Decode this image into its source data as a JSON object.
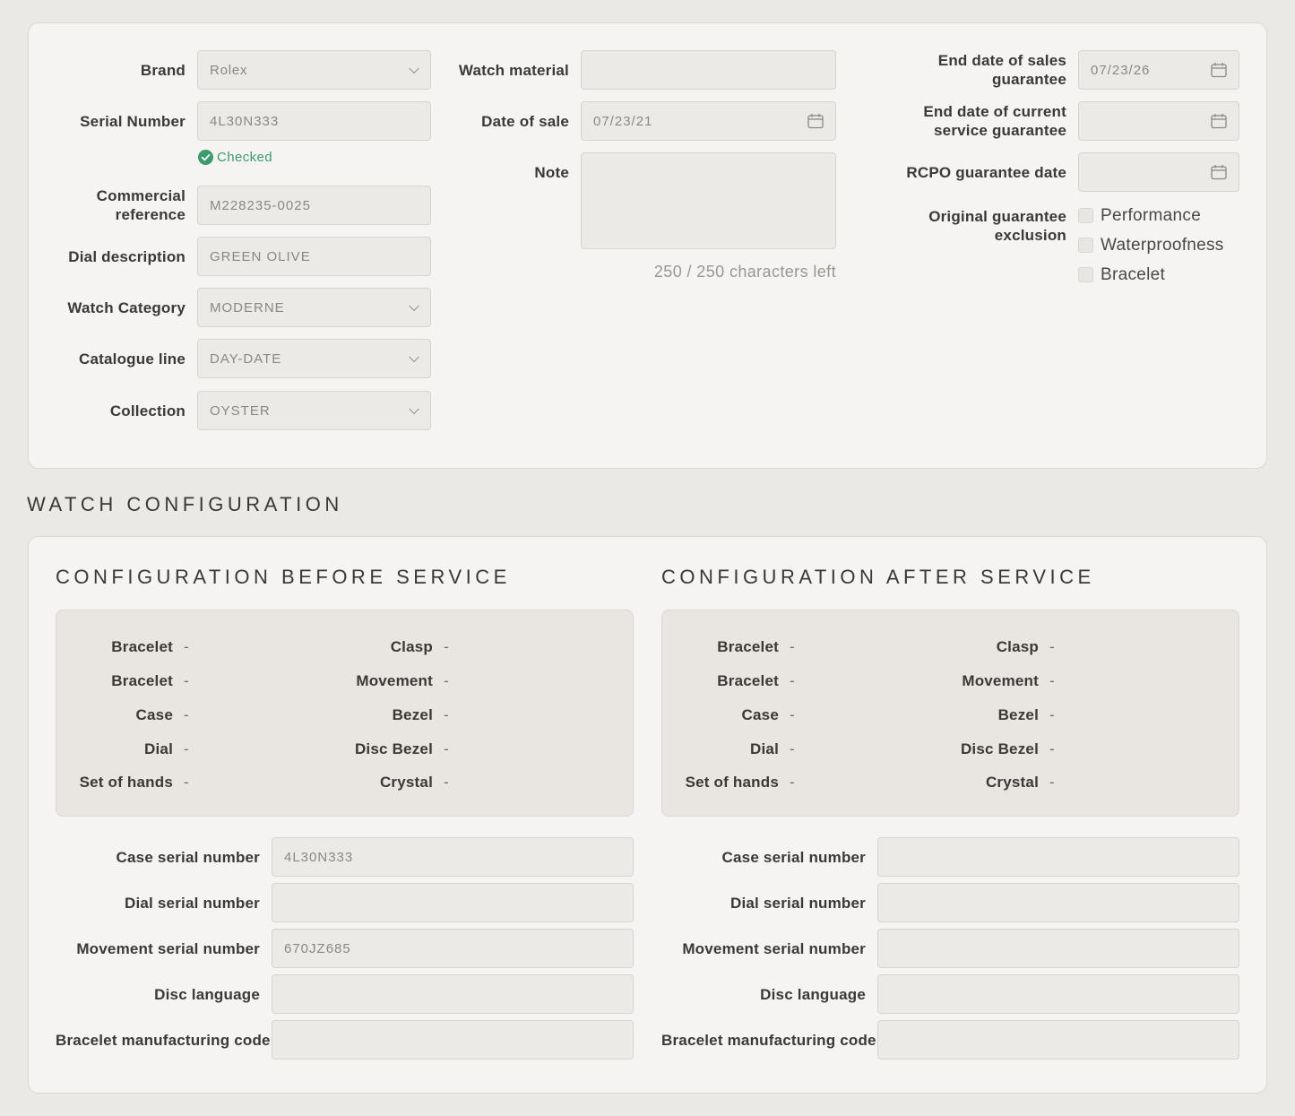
{
  "info": {
    "brand": {
      "label": "Brand",
      "value": "Rolex"
    },
    "serial": {
      "label": "Serial Number",
      "value": "4L30N333",
      "status": "Checked"
    },
    "commercial_ref": {
      "label_line1": "Commercial",
      "label_line2": "reference",
      "value": "M228235-0025"
    },
    "dial_desc": {
      "label": "Dial description",
      "value": "GREEN OLIVE"
    },
    "watch_category": {
      "label": "Watch Category",
      "value": "MODERNE"
    },
    "catalogue_line": {
      "label": "Catalogue line",
      "value": "DAY-DATE"
    },
    "collection": {
      "label": "Collection",
      "value": "OYSTER"
    },
    "watch_material": {
      "label": "Watch material",
      "value": ""
    },
    "date_of_sale": {
      "label": "Date of sale",
      "value": "07/23/21"
    },
    "note": {
      "label": "Note",
      "value": "",
      "counter": "250 / 250 characters left"
    },
    "end_sales_guarantee": {
      "label_line1": "End date of sales",
      "label_line2": "guarantee",
      "value": "07/23/26"
    },
    "end_service_guarantee": {
      "label_line1": "End date of current",
      "label_line2": "service guarantee",
      "value": ""
    },
    "rcpo_guarantee": {
      "label": "RCPO guarantee date",
      "value": ""
    },
    "exclusion": {
      "label_line1": "Original guarantee",
      "label_line2": "exclusion",
      "options": [
        "Performance",
        "Waterproofness",
        "Bracelet"
      ]
    }
  },
  "config": {
    "section_title": "WATCH CONFIGURATION",
    "before": {
      "title": "CONFIGURATION BEFORE SERVICE",
      "left": [
        {
          "label": "Bracelet",
          "value": "-"
        },
        {
          "label": "Bracelet",
          "value": "-"
        },
        {
          "label": "Case",
          "value": "-"
        },
        {
          "label": "Dial",
          "value": "-"
        },
        {
          "label": "Set of hands",
          "value": "-"
        }
      ],
      "right": [
        {
          "label": "Clasp",
          "value": "-"
        },
        {
          "label": "Movement",
          "value": "-"
        },
        {
          "label": "Bezel",
          "value": "-"
        },
        {
          "label": "Disc Bezel",
          "value": "-"
        },
        {
          "label": "Crystal",
          "value": "-"
        }
      ],
      "fields": [
        {
          "label": "Case serial number",
          "value": "4L30N333"
        },
        {
          "label": "Dial serial number",
          "value": ""
        },
        {
          "label": "Movement serial number",
          "value": "670JZ685"
        },
        {
          "label": "Disc language",
          "value": ""
        },
        {
          "label": "Bracelet manufacturing code",
          "value": ""
        }
      ]
    },
    "after": {
      "title": "CONFIGURATION AFTER SERVICE",
      "left": [
        {
          "label": "Bracelet",
          "value": "-"
        },
        {
          "label": "Bracelet",
          "value": "-"
        },
        {
          "label": "Case",
          "value": "-"
        },
        {
          "label": "Dial",
          "value": "-"
        },
        {
          "label": "Set of hands",
          "value": "-"
        }
      ],
      "right": [
        {
          "label": "Clasp",
          "value": "-"
        },
        {
          "label": "Movement",
          "value": "-"
        },
        {
          "label": "Bezel",
          "value": "-"
        },
        {
          "label": "Disc Bezel",
          "value": "-"
        },
        {
          "label": "Crystal",
          "value": "-"
        }
      ],
      "fields": [
        {
          "label": "Case serial number",
          "value": ""
        },
        {
          "label": "Dial serial number",
          "value": ""
        },
        {
          "label": "Movement serial number",
          "value": ""
        },
        {
          "label": "Disc language",
          "value": ""
        },
        {
          "label": "Bracelet manufacturing code",
          "value": ""
        }
      ]
    }
  },
  "colors": {
    "checked": "#3d9a6a",
    "accent_text": "#3a3835"
  },
  "icons": {
    "check": "check-circle-icon",
    "calendar": "calendar-icon",
    "dropdown": "chevron-down-icon"
  }
}
